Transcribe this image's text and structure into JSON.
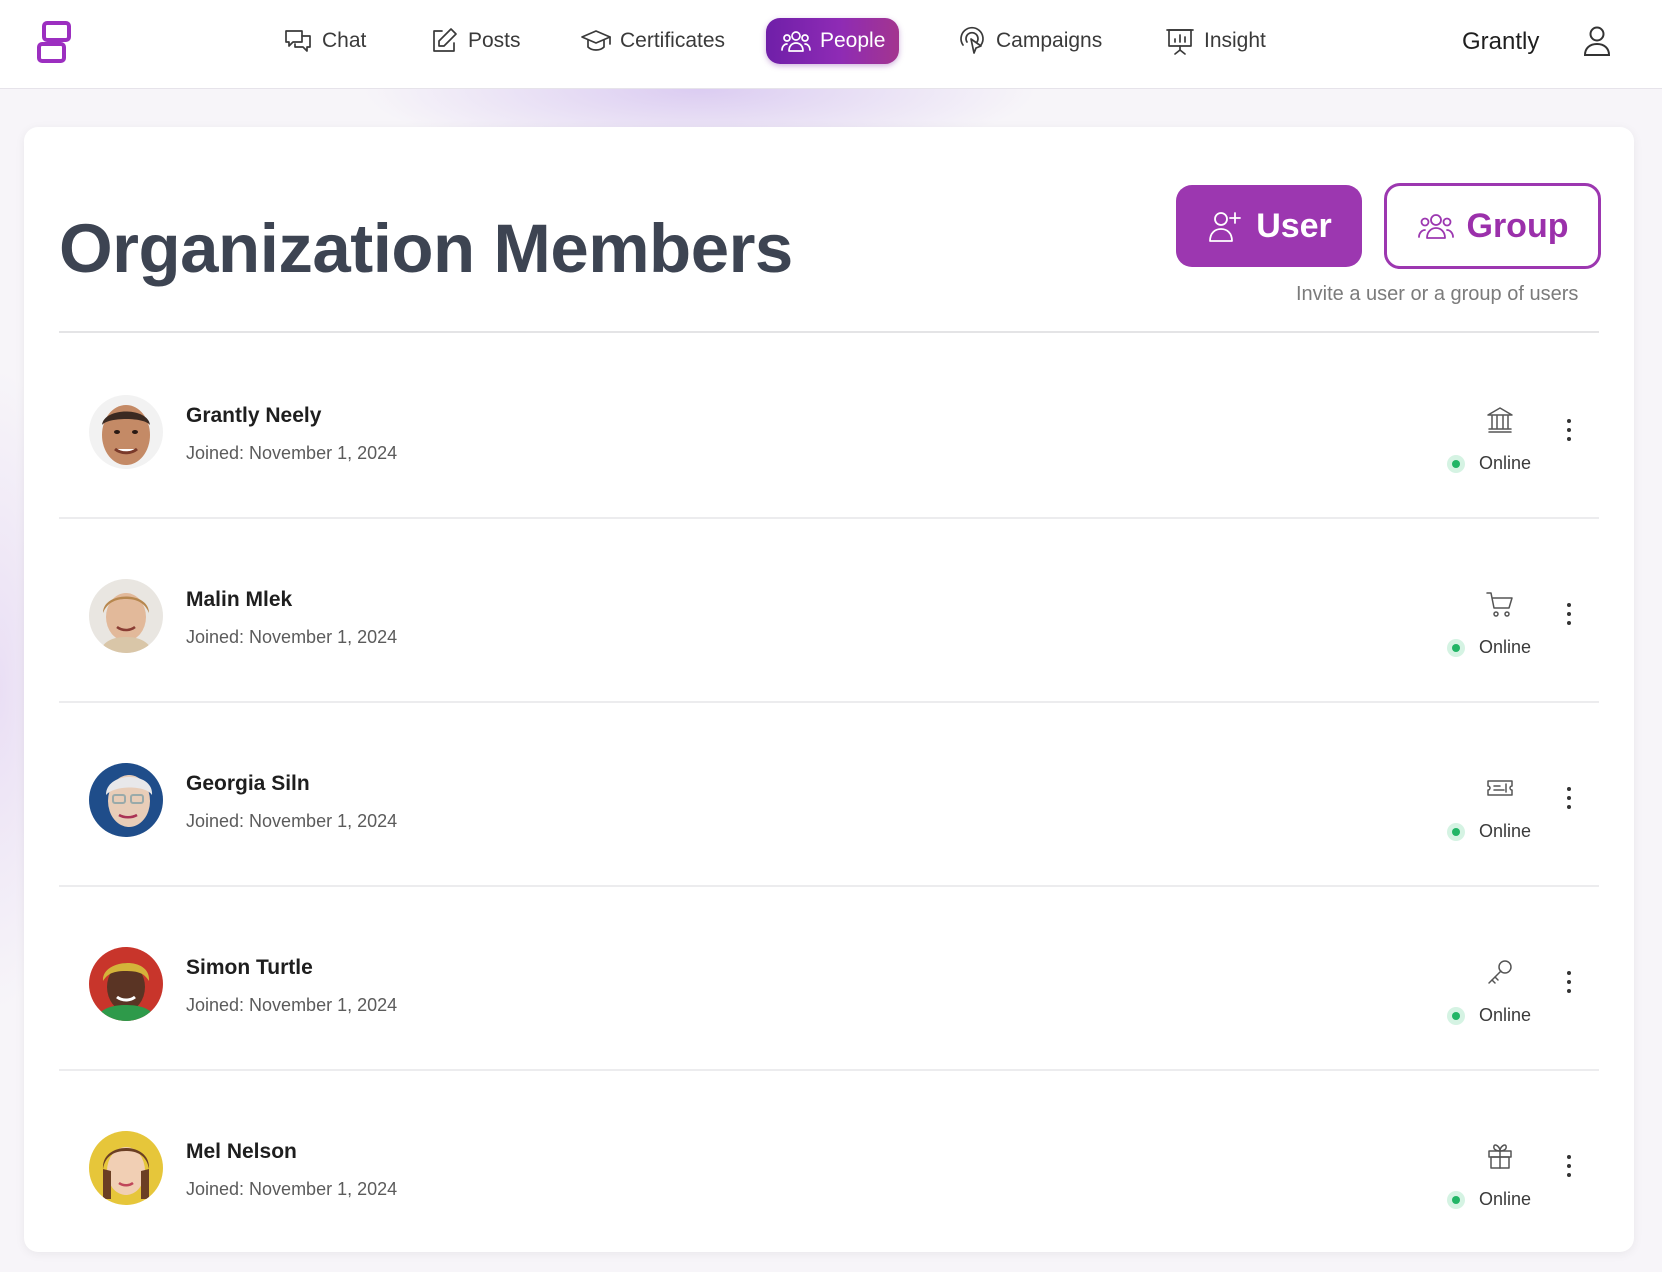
{
  "nav": {
    "items": [
      {
        "label": "Chat",
        "icon": "chat-bubbles-icon"
      },
      {
        "label": "Posts",
        "icon": "pencil-square-icon"
      },
      {
        "label": "Certificates",
        "icon": "graduation-cap-icon"
      },
      {
        "label": "People",
        "icon": "people-group-icon",
        "active": true
      },
      {
        "label": "Campaigns",
        "icon": "broadcast-pointer-icon"
      },
      {
        "label": "Insight",
        "icon": "presentation-chart-icon"
      }
    ],
    "org_name": "Grantly",
    "accent_color": "#8e2bb5"
  },
  "page": {
    "title": "Organization Members",
    "user_button": "User",
    "group_button": "Group",
    "invite_hint": "Invite a user or a group of users"
  },
  "members": [
    {
      "name": "Grantly Neely",
      "joined": "Joined: November 1, 2024",
      "role_icon": "bank-icon",
      "status": "Online"
    },
    {
      "name": "Malin Mlek",
      "joined": "Joined: November 1, 2024",
      "role_icon": "cart-icon",
      "status": "Online"
    },
    {
      "name": "Georgia Siln",
      "joined": "Joined: November 1, 2024",
      "role_icon": "ticket-icon",
      "status": "Online"
    },
    {
      "name": "Simon Turtle",
      "joined": "Joined: November 1, 2024",
      "role_icon": "key-icon",
      "status": "Online"
    },
    {
      "name": "Mel Nelson",
      "joined": "Joined: November 1, 2024",
      "role_icon": "gift-icon",
      "status": "Online"
    }
  ],
  "colors": {
    "online": "#22b566",
    "primary_button": "#9c37b0"
  }
}
